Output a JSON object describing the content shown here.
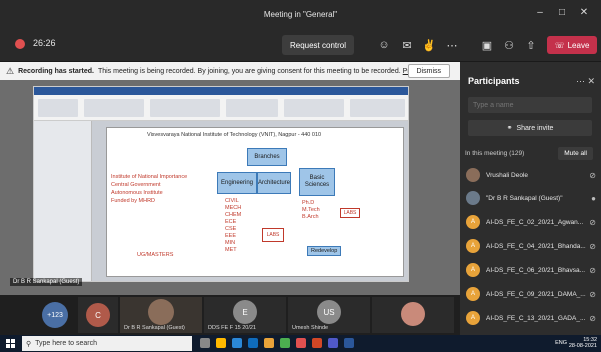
{
  "window": {
    "title": "Meeting in \"General\"",
    "min_icon": "minimize-icon",
    "max_icon": "maximize-icon",
    "close_icon": "close-icon"
  },
  "toolbar": {
    "timer": "26:26",
    "request_control": "Request control",
    "leave": "Leave",
    "icons": [
      "people-icon",
      "chat-icon",
      "reactions-icon",
      "more-icon",
      "camera-icon",
      "mic-off-icon",
      "share-icon",
      "phone-icon"
    ]
  },
  "banner": {
    "bold": "Recording has started.",
    "text": "This meeting is being recorded. By joining, you are giving consent for this meeting to be recorded.",
    "policy": "Priv...",
    "dismiss": "Dismiss"
  },
  "stage": {
    "slide_header": "Visvesvaraya National Institute of Technology (VNIT), Nagpur - 440 010",
    "boxes": {
      "branches": "Branches",
      "engineering": "Engineering",
      "architecture": "Architecture",
      "basic_sciences": "Basic Sciences"
    },
    "red_lines": [
      "Institute of National Importance",
      "Central Government",
      "Autonomous Institute",
      "Funded by MHRD"
    ],
    "red_list": [
      "CIVIL",
      "MECH",
      "CHEM",
      "ECE",
      "CSE",
      "EEE",
      "MIN",
      "MET"
    ],
    "right_list": [
      "Ph.D",
      "M.Tech",
      "B.Arch"
    ],
    "labs_label": "LABS",
    "under_label": "UG/MASTERS",
    "redevelop": "Redevelop",
    "presenter": "Dr B R Sankapal (Guest)"
  },
  "gallery": {
    "overflow": "+123",
    "tiles": [
      {
        "initials": "C",
        "label": ""
      },
      {
        "initials": "",
        "label": "Dr B R Sankapal (Guest)"
      },
      {
        "initials": "E",
        "label": "DDS FE F 15 20/21"
      },
      {
        "initials": "US",
        "label": "Umesh Shinde"
      },
      {
        "initials": "",
        "label": ""
      }
    ]
  },
  "participants": {
    "title": "Participants",
    "search_placeholder": "Type a name",
    "share_invite": "Share invite",
    "in_meeting": "In this meeting (129)",
    "mute_all": "Mute all",
    "list": [
      {
        "name": "Vrushali Deole",
        "initials": "VD",
        "color": "#8a6d5a"
      },
      {
        "name": "\"Dr B R Sankapal (Guest)\"",
        "initials": "BS",
        "color": "#6b7a8a"
      },
      {
        "name": "AI-DS_FE_C_02_20/21_Agwan...",
        "initials": "A",
        "color": "#e8a33a"
      },
      {
        "name": "AI-DS_FE_C_04_20/21_Bhanda...",
        "initials": "A",
        "color": "#e8a33a"
      },
      {
        "name": "AI-DS_FE_C_06_20/21_Bhavsa...",
        "initials": "A",
        "color": "#e8a33a"
      },
      {
        "name": "AI-DS_FE_C_09_20/21_DAMA_...",
        "initials": "A",
        "color": "#e8a33a"
      },
      {
        "name": "AI-DS_FE_C_13_20/21_GADA_...",
        "initials": "A",
        "color": "#e8a33a"
      }
    ]
  },
  "taskbar": {
    "search_placeholder": "Type here to search",
    "lang": "ENG",
    "time": "15:32",
    "date": "28-08-2021"
  }
}
